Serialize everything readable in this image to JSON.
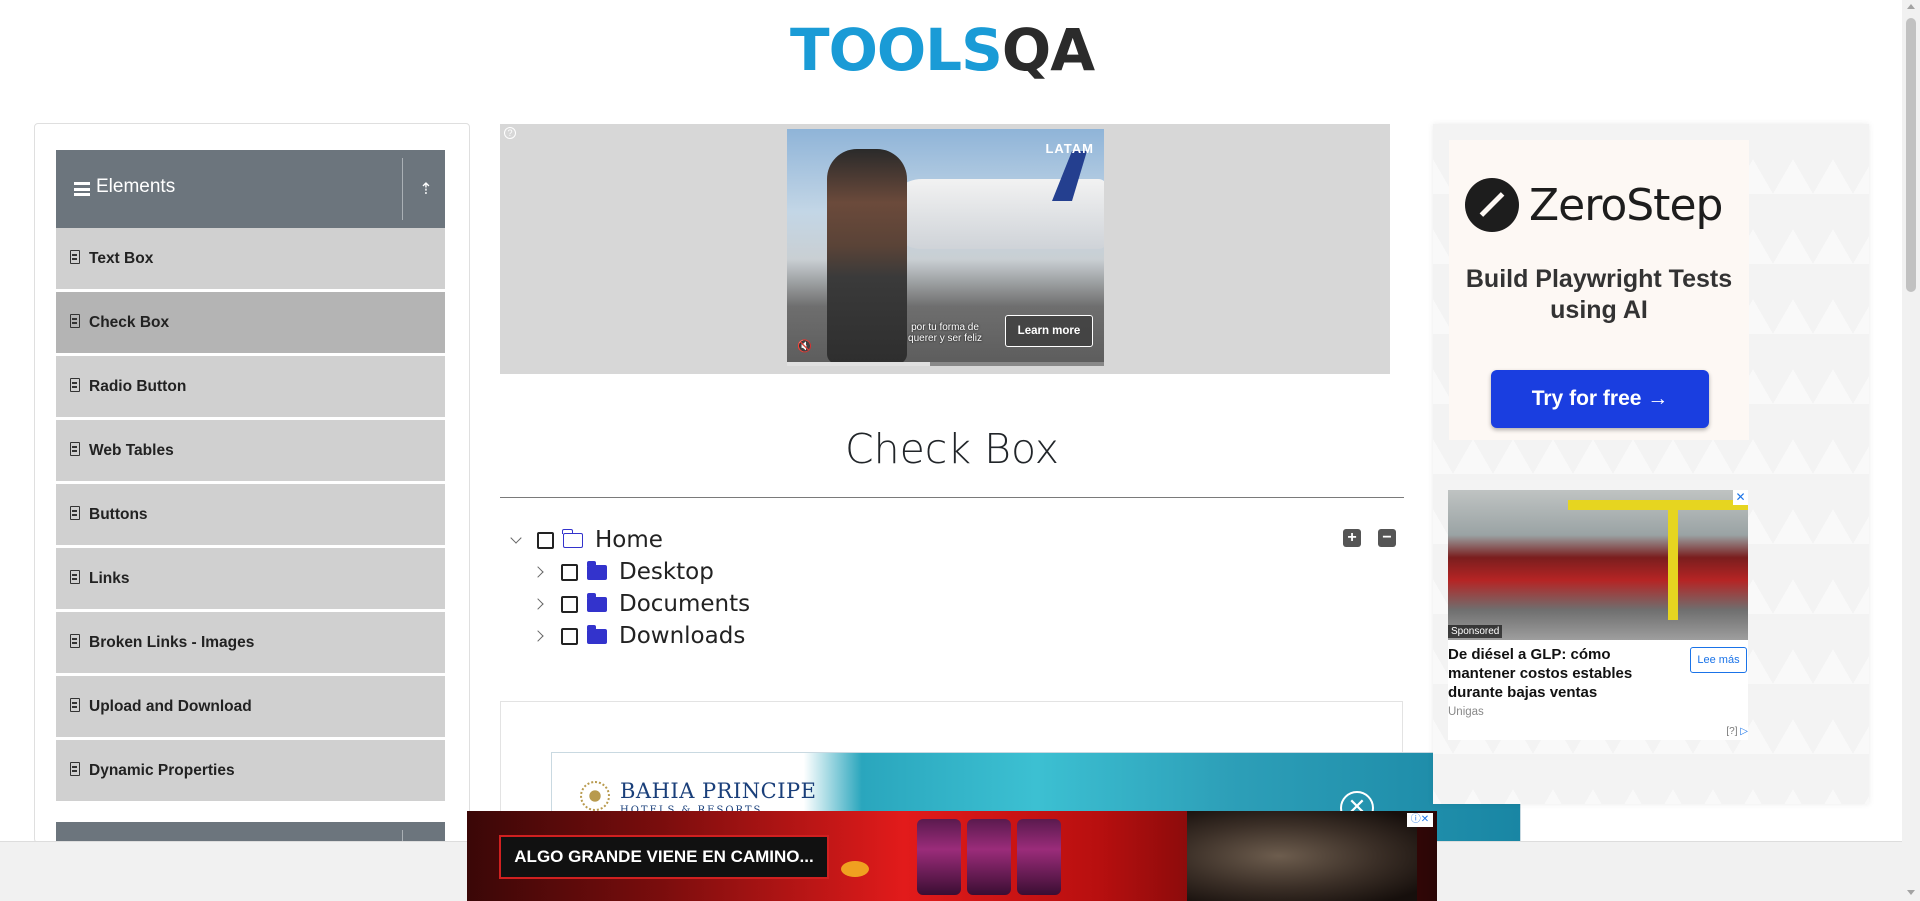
{
  "header": {
    "logo_tools": "TOOLS",
    "logo_qa": "QA"
  },
  "sidebar": {
    "group_title": "Elements",
    "items": [
      {
        "label": "Text Box"
      },
      {
        "label": "Check Box",
        "active": true
      },
      {
        "label": "Radio Button"
      },
      {
        "label": "Web Tables"
      },
      {
        "label": "Buttons"
      },
      {
        "label": "Links"
      },
      {
        "label": "Broken Links - Images"
      },
      {
        "label": "Upload and Download"
      },
      {
        "label": "Dynamic Properties"
      }
    ]
  },
  "ad_top": {
    "info_icon": "?",
    "brand": "LATAM",
    "caption": "por tu forma de querer y ser feliz",
    "cta": "Learn more",
    "progress": 0.45
  },
  "main": {
    "title": "Check Box",
    "tree": {
      "root": "Home",
      "children": [
        "Desktop",
        "Documents",
        "Downloads"
      ],
      "expand_all_icon": "+",
      "collapse_all_icon": "−"
    }
  },
  "ad_right": {
    "zerostep": {
      "brand": "ZeroStep",
      "tagline": "Build Playwright Tests using AI",
      "cta": "Try for free →"
    },
    "glp": {
      "sponsored": "Sponsored",
      "title": "De diésel a GLP: cómo mantener costos estables durante bajas ventas",
      "button": "Lee más",
      "advertiser": "Unigas",
      "ad_tag": "[?]"
    }
  },
  "ad_bahia": {
    "name": "BAHIA PRINCIPE",
    "sub": "HOTELS & RESORTS",
    "close": "✕"
  },
  "ad_bottom": {
    "slogan": "ALGO GRANDE VIENE EN CAMINO..."
  },
  "colors": {
    "sidebar_header": "#6c757d",
    "menu_item": "#d0d0d0",
    "menu_item_active": "#b4b4b4",
    "logo_blue": "#1a9bd6",
    "folder_blue": "#3333cc",
    "cta_blue": "#1a3ee0"
  }
}
